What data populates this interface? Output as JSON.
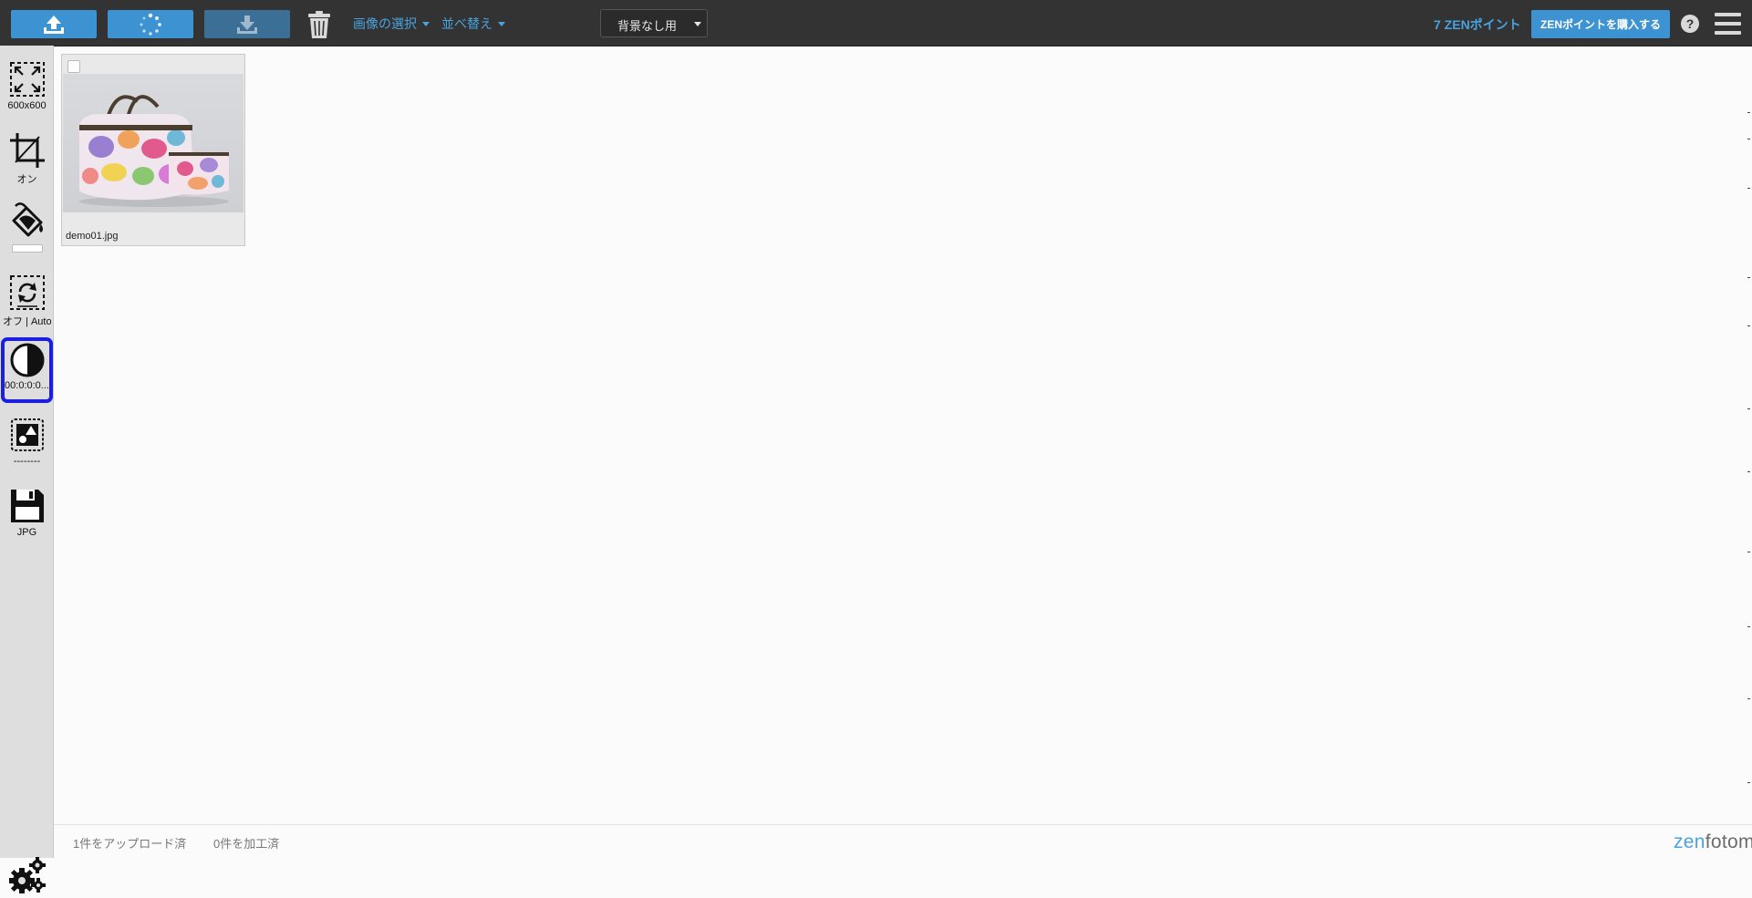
{
  "toolbar": {
    "upload_icon": "upload-icon",
    "process_icon": "spinner-icon",
    "download_icon": "download-icon",
    "trash_icon": "trash-icon",
    "select_images_label": "画像の選択",
    "sort_label": "並べ替え",
    "preset_select_value": "背景なし用",
    "points_label": "7 ZENポイント",
    "buy_points_label": "ZENポイントを購入する",
    "help_label": "?",
    "menu_icon": "hamburger-menu-icon",
    "accent_color": "#3d93d1",
    "link_color": "#4aa3df"
  },
  "sidebar": {
    "tools": [
      {
        "name": "resize",
        "icon": "resize-icon",
        "label": "600x600"
      },
      {
        "name": "crop",
        "icon": "crop-icon",
        "label": "オン"
      },
      {
        "name": "background-fill",
        "icon": "paint-bucket-icon",
        "label": ""
      },
      {
        "name": "rotate",
        "icon": "auto-rotate-icon",
        "label": "オフ | Auto"
      },
      {
        "name": "contrast",
        "icon": "contrast-icon",
        "label": "00:0:0:0..."
      },
      {
        "name": "watermark",
        "icon": "watermark-icon",
        "label": "--------"
      },
      {
        "name": "format",
        "icon": "save-floppy-icon",
        "label": "JPG"
      }
    ],
    "active_tool": "contrast",
    "active_border_color": "#1c1ee0",
    "settings_icon": "settings-gears-icon"
  },
  "gallery": {
    "items": [
      {
        "filename": "demo01.jpg",
        "checked": false
      }
    ]
  },
  "status": {
    "uploaded": "1件をアップロード済",
    "processed": "0件を加工済",
    "brand_part1": "zen",
    "brand_part2": "fotomatic"
  }
}
